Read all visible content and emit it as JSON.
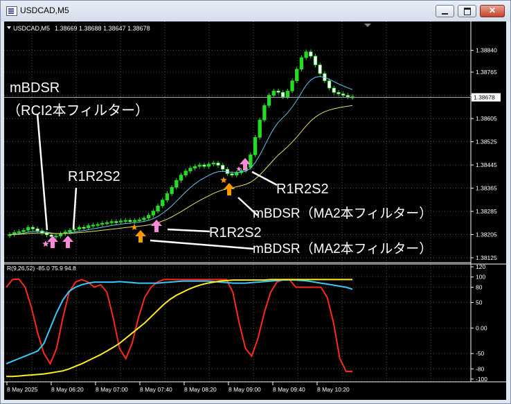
{
  "window": {
    "title": "USDCAD,M5"
  },
  "chart_data": {
    "type": "line",
    "symbol_label": "USDCAD,M5",
    "ohlc": "1.38669 1.38688 1.38647 1.38678",
    "last_price_tag": "1.38678",
    "price_axis_ticks": [
      "1.38840",
      "1.38765",
      "1.38685",
      "1.38605",
      "1.38525",
      "1.38445",
      "1.38365",
      "1.38285",
      "1.38205",
      "1.38125"
    ],
    "ylim": [
      1.38125,
      1.38875
    ],
    "time_axis_labels": [
      "8 May 2025",
      "8 May 06:20",
      "8 May 07:00",
      "8 May 07:40",
      "8 May 08:20",
      "8 May 09:00",
      "8 May 09:40",
      "8 May 10:20"
    ],
    "candles_close": [
      1.38205,
      1.38212,
      1.38215,
      1.3822,
      1.3823,
      1.38225,
      1.38218,
      1.3821,
      1.38204,
      1.38198,
      1.382,
      1.38208,
      1.38214,
      1.3822,
      1.38224,
      1.3823,
      1.38228,
      1.38236,
      1.38238,
      1.3824,
      1.38244,
      1.38246,
      1.3825,
      1.38248,
      1.38252,
      1.38254,
      1.3825,
      1.38254,
      1.38256,
      1.38262,
      1.38272,
      1.38286,
      1.38304,
      1.38324,
      1.38346,
      1.38368,
      1.38392,
      1.3841,
      1.38424,
      1.38434,
      1.3844,
      1.38445,
      1.3844,
      1.38448,
      1.38452,
      1.38444,
      1.3843,
      1.38415,
      1.3841,
      1.38418,
      1.38426,
      1.38436,
      1.3848,
      1.3854,
      1.386,
      1.3865,
      1.38685,
      1.387,
      1.38695,
      1.3868,
      1.387,
      1.38735,
      1.38775,
      1.38815,
      1.38835,
      1.3882,
      1.3879,
      1.3876,
      1.38735,
      1.3871,
      1.38695,
      1.3869,
      1.38685,
      1.3868,
      1.38678
    ],
    "annotations": [
      {
        "text": "mBDSR"
      },
      {
        "text": "（RCI2本フィルター）"
      },
      {
        "text": "R1R2S2"
      },
      {
        "text": "R1R2S2"
      },
      {
        "text": "mBDSR（MA2本フィルター）"
      },
      {
        "text": "R1R2S2"
      },
      {
        "text": "mBDSR（MA2本フィルター）"
      }
    ],
    "indicator": {
      "label": "R(9,26,52) -85.0 75.9 94.8",
      "ylim": [
        -100,
        120
      ],
      "ticks": [
        "120",
        "100",
        "80",
        "50",
        "0.00",
        "-50",
        "-80",
        "-100"
      ],
      "series": [
        {
          "color": "#ff2a1a",
          "values": [
            80,
            95,
            96,
            80,
            40,
            -10,
            -50,
            -70,
            -40,
            20,
            70,
            90,
            95,
            90,
            80,
            85,
            70,
            20,
            -40,
            -60,
            -30,
            20,
            60,
            80,
            90,
            95,
            95,
            95,
            95,
            95,
            95,
            95,
            95,
            95,
            95,
            95,
            70,
            10,
            -40,
            -55,
            -20,
            30,
            70,
            90,
            95,
            95,
            80,
            80,
            80,
            80,
            80,
            60,
            10,
            -60,
            -85,
            -85
          ]
        },
        {
          "color": "#33ccff",
          "values": [
            -70,
            -65,
            -60,
            -55,
            -50,
            -45,
            -30,
            0,
            30,
            55,
            72,
            80,
            85,
            88,
            90,
            90,
            90,
            90,
            91,
            90,
            89,
            88,
            88,
            88,
            88,
            89,
            90,
            91,
            92,
            92,
            92,
            92,
            92,
            91,
            90,
            89,
            88,
            88,
            88,
            89,
            90,
            91,
            92,
            93,
            94,
            94,
            94,
            93,
            92,
            90,
            88,
            86,
            84,
            82,
            80,
            76
          ]
        },
        {
          "color": "#ffee22",
          "values": [
            -95,
            -95,
            -94,
            -93,
            -92,
            -91,
            -90,
            -88,
            -86,
            -84,
            -80,
            -75,
            -70,
            -64,
            -58,
            -52,
            -45,
            -38,
            -30,
            -20,
            -10,
            0,
            10,
            22,
            34,
            46,
            56,
            64,
            70,
            76,
            81,
            85,
            88,
            90,
            92,
            93,
            94,
            94,
            94,
            94,
            94,
            94,
            95,
            95,
            95,
            95,
            95,
            95,
            95,
            95,
            95,
            95,
            95,
            95,
            95,
            95
          ]
        }
      ]
    }
  }
}
